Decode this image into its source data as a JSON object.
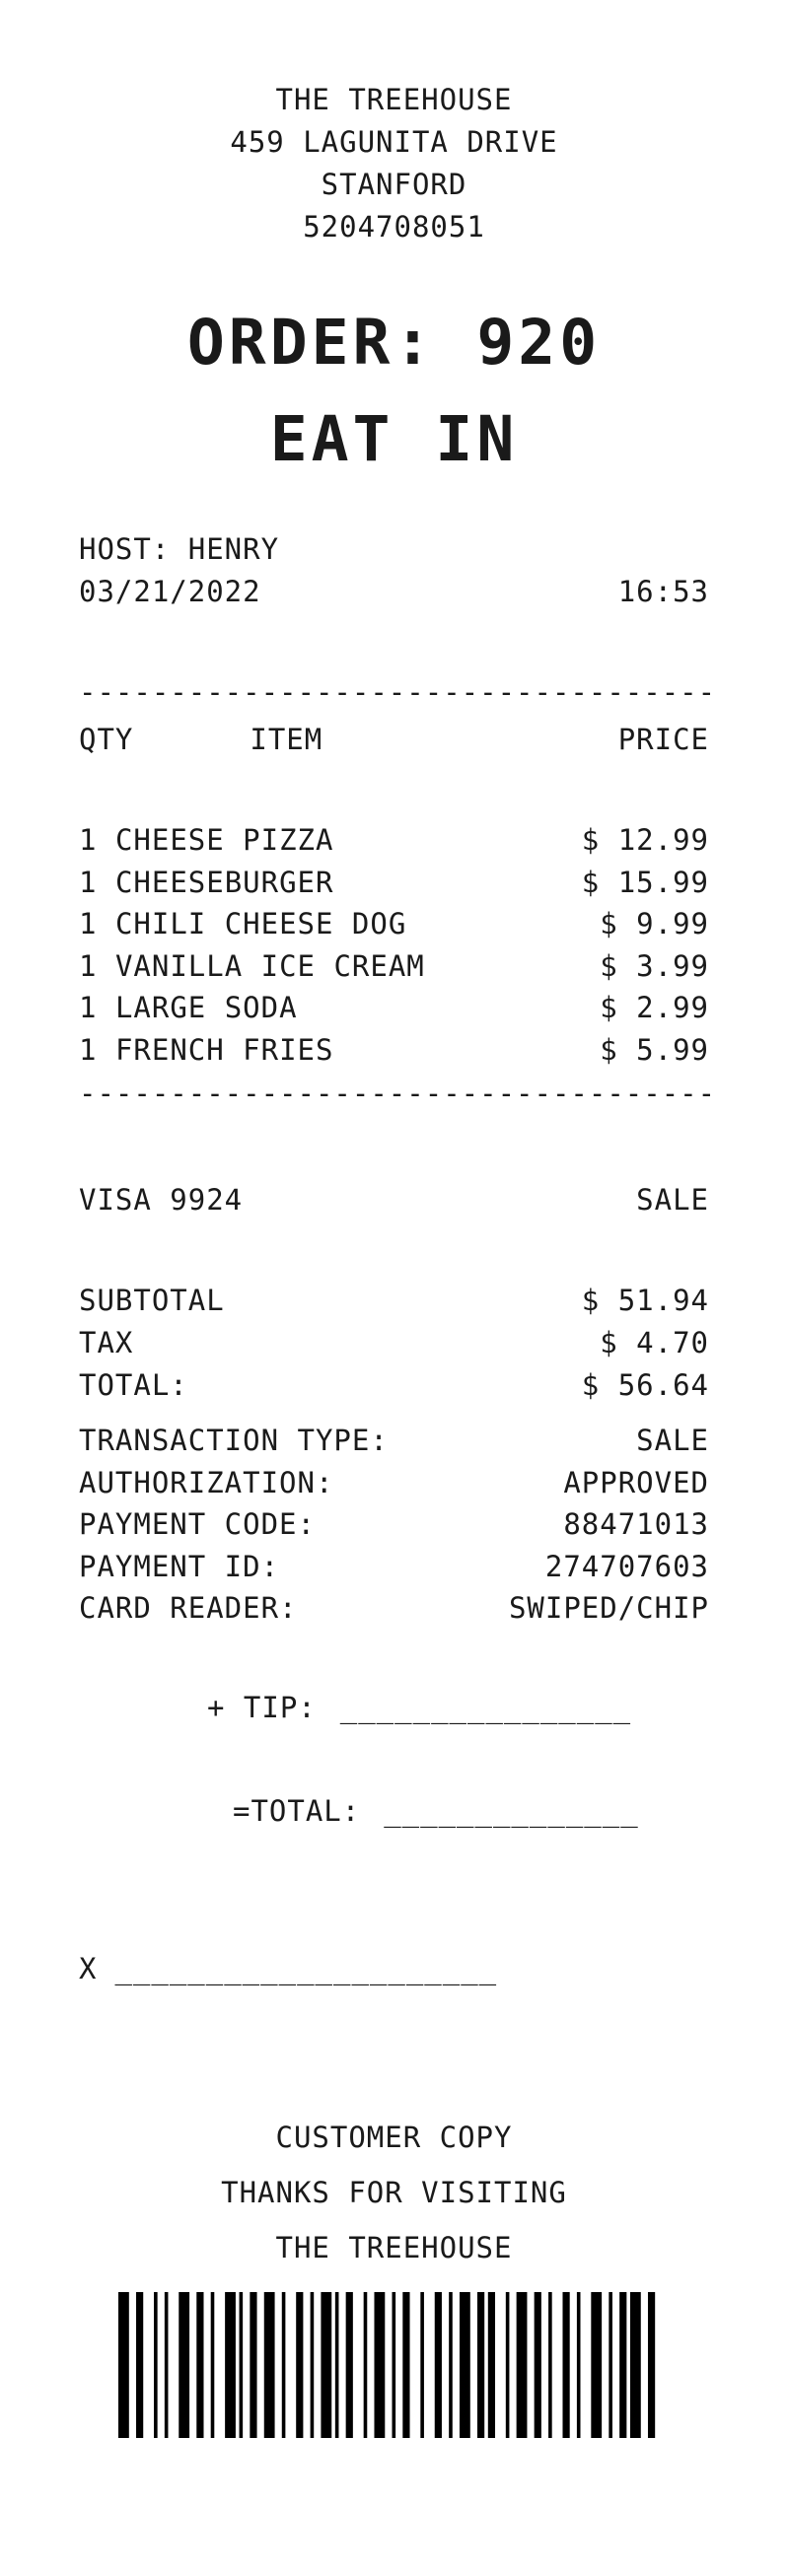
{
  "header": {
    "name": "THE TREEHOUSE",
    "address": "459 LAGUNITA DRIVE",
    "city": "STANFORD",
    "phone": "5204708051"
  },
  "order": {
    "label": "ORDER: 920",
    "type": "EAT IN"
  },
  "meta": {
    "host": "HOST: HENRY",
    "date": "03/21/2022",
    "time": "16:53"
  },
  "divider": "--------------------------------------",
  "columns": {
    "qty": "QTY",
    "item": "ITEM",
    "price": "PRICE"
  },
  "items": [
    {
      "qty": "1",
      "name": "CHEESE PIZZA",
      "price": "$ 12.99"
    },
    {
      "qty": "1",
      "name": "CHEESEBURGER",
      "price": "$ 15.99"
    },
    {
      "qty": "1",
      "name": "CHILI CHEESE DOG",
      "price": "$ 9.99"
    },
    {
      "qty": "1",
      "name": "VANILLA ICE CREAM",
      "price": "$ 3.99"
    },
    {
      "qty": "1",
      "name": "LARGE SODA",
      "price": "$ 2.99"
    },
    {
      "qty": "1",
      "name": "FRENCH FRIES",
      "price": "$ 5.99"
    }
  ],
  "payment": {
    "card": "VISA 9924",
    "mode": "SALE"
  },
  "totals": {
    "subtotal_label": "SUBTOTAL",
    "subtotal": "$ 51.94",
    "tax_label": "TAX",
    "tax": "$ 4.70",
    "total_label": "TOTAL:",
    "total": "$ 56.64"
  },
  "transaction": [
    {
      "label": "TRANSACTION TYPE:",
      "value": "SALE"
    },
    {
      "label": "AUTHORIZATION:",
      "value": "APPROVED"
    },
    {
      "label": "PAYMENT CODE:",
      "value": "88471013"
    },
    {
      "label": "PAYMENT ID:",
      "value": "274707603"
    },
    {
      "label": "CARD READER:",
      "value": "SWIPED/CHIP"
    }
  ],
  "tip": {
    "label": "+ TIP:",
    "blank": "________________"
  },
  "grand_total": {
    "label": "=TOTAL:",
    "blank": "______________"
  },
  "signature": {
    "label": "X",
    "blank": "_____________________"
  },
  "footer": {
    "copy": "CUSTOMER COPY",
    "thanks": "THANKS FOR VISITING",
    "name": "THE TREEHOUSE"
  },
  "barcode_pattern": [
    3,
    2,
    2,
    3,
    1,
    2,
    1,
    3,
    3,
    2,
    2,
    2,
    1,
    3,
    3,
    1,
    1,
    2,
    2,
    2,
    3,
    2,
    1,
    3,
    2,
    2,
    1,
    2,
    3,
    1,
    1,
    2,
    2,
    3,
    1,
    2,
    3,
    2,
    1,
    2,
    2,
    3,
    1,
    3,
    2,
    2,
    1,
    2,
    3,
    2,
    2,
    1,
    2,
    3,
    1,
    2,
    3,
    2,
    2,
    2,
    1,
    3,
    2,
    2,
    1,
    3,
    3,
    2,
    1,
    2,
    2,
    1,
    3,
    2,
    2,
    3
  ]
}
